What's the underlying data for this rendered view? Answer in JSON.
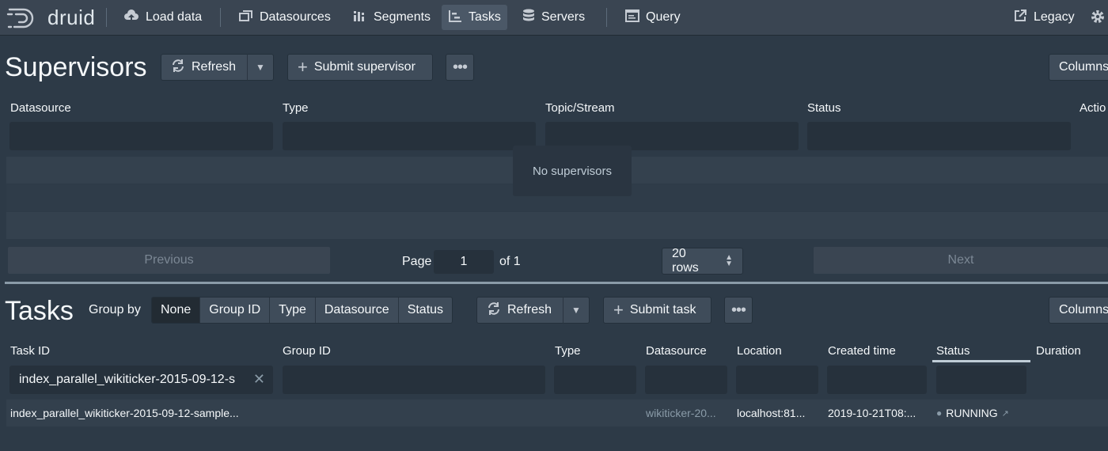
{
  "nav": {
    "logo": "druid",
    "items": [
      {
        "label": "Load data",
        "icon": "cloud-upload-icon"
      },
      {
        "label": "Datasources",
        "icon": "datasources-icon"
      },
      {
        "label": "Segments",
        "icon": "segments-icon"
      },
      {
        "label": "Tasks",
        "icon": "tasks-icon",
        "active": true
      },
      {
        "label": "Servers",
        "icon": "database-icon"
      },
      {
        "label": "Query",
        "icon": "console-icon"
      }
    ],
    "legacy": "Legacy"
  },
  "supervisors": {
    "title": "Supervisors",
    "refresh": "Refresh",
    "submit": "Submit supervisor",
    "columns_btn": "Columns",
    "headers": [
      "Datasource",
      "Type",
      "Topic/Stream",
      "Status",
      "Actio"
    ],
    "empty": "No supervisors",
    "pagination": {
      "previous": "Previous",
      "page_label": "Page",
      "page_value": "1",
      "of": "of 1",
      "rows": "20 rows",
      "next": "Next"
    }
  },
  "tasks": {
    "title": "Tasks",
    "group_by_label": "Group by",
    "group_options": [
      "None",
      "Group ID",
      "Type",
      "Datasource",
      "Status"
    ],
    "refresh": "Refresh",
    "submit": "Submit task",
    "columns_btn": "Columns",
    "headers": [
      "Task ID",
      "Group ID",
      "Type",
      "Datasource",
      "Location",
      "Created time",
      "Status",
      "Duration"
    ],
    "task_id_filter": "index_parallel_wikiticker-2015-09-12-s",
    "row": {
      "task_id": "index_parallel_wikiticker-2015-09-12-sample...",
      "datasource": "wikiticker-20...",
      "location": "localhost:81...",
      "created": "2019-10-21T08:...",
      "status": "RUNNING"
    }
  }
}
